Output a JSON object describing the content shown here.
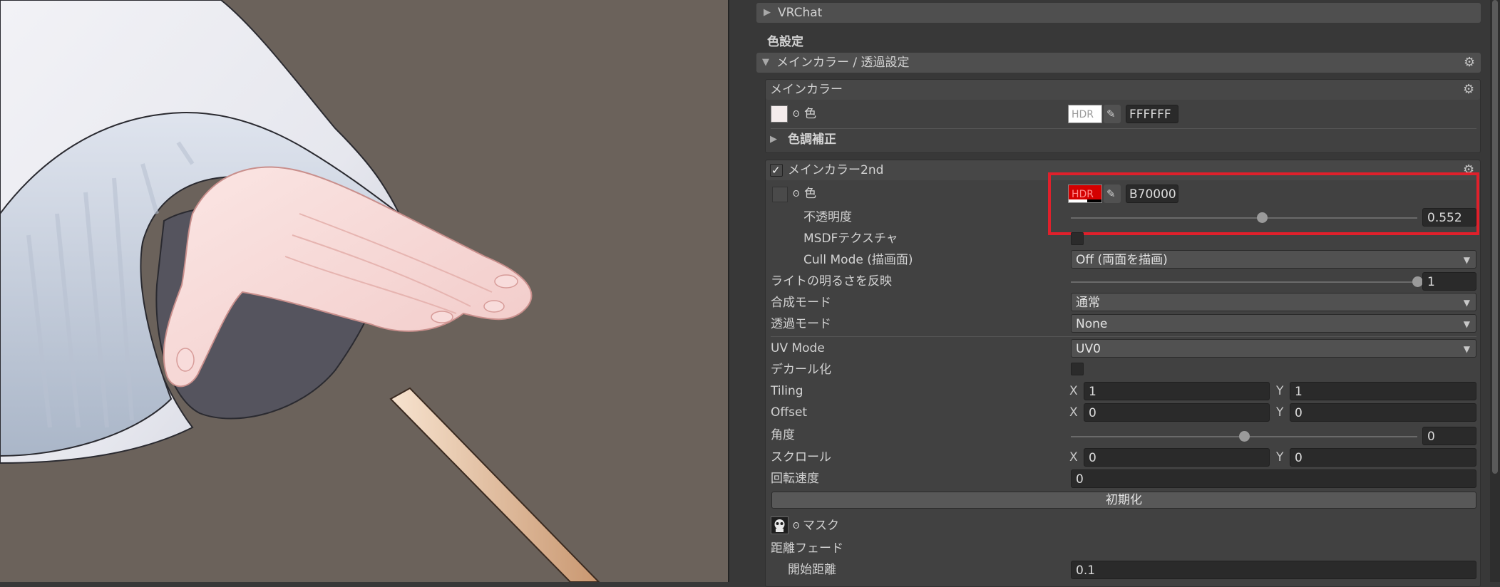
{
  "inspector": {
    "vrchat_foldout": "VRChat",
    "color_settings_heading": "色設定",
    "main_color_foldout": "メインカラー / 透過設定",
    "main_color_section": {
      "title": "メインカラー",
      "color_label": "色",
      "hdr_label": "HDR",
      "hex": "FFFFFF",
      "color_adjust_label": "色調補正"
    },
    "main_color_2nd": {
      "title": "メインカラー2nd",
      "enabled": true,
      "color_label": "色",
      "hdr_label": "HDR",
      "hex": "B70000",
      "swatch_color": "#d40000",
      "opacity_label": "不透明度",
      "opacity_value": "0.552",
      "opacity": 0.552,
      "msdf_label": "MSDFテクスチャ",
      "cull_label": "Cull Mode (描画面)",
      "cull_value": "Off (両面を描画)",
      "light_label": "ライトの明るさを反映",
      "light_value": "1",
      "light": 1,
      "blend_label": "合成モード",
      "blend_value": "通常",
      "alpha_label": "透過モード",
      "alpha_value": "None",
      "uv_label": "UV Mode",
      "uv_value": "UV0",
      "decal_label": "デカール化",
      "tiling_label": "Tiling",
      "tiling_x": "1",
      "tiling_y": "1",
      "offset_label": "Offset",
      "offset_x": "0",
      "offset_y": "0",
      "angle_label": "角度",
      "angle_value": "0",
      "angle_fraction": 0.5,
      "scroll_label": "スクロール",
      "scroll_x": "0",
      "scroll_y": "0",
      "rotate_label": "回転速度",
      "rotate_value": "0",
      "reset_label": "初期化",
      "mask_label": "マスク",
      "distance_fade_label": "距離フェード",
      "start_distance_label": "開始距離",
      "start_distance_value": "0.1"
    },
    "x_label": "X",
    "y_label": "Y"
  },
  "colors": {
    "highlight": "#e0202b",
    "viewport_bg": "#6b625b",
    "panel_bg": "#383838"
  }
}
